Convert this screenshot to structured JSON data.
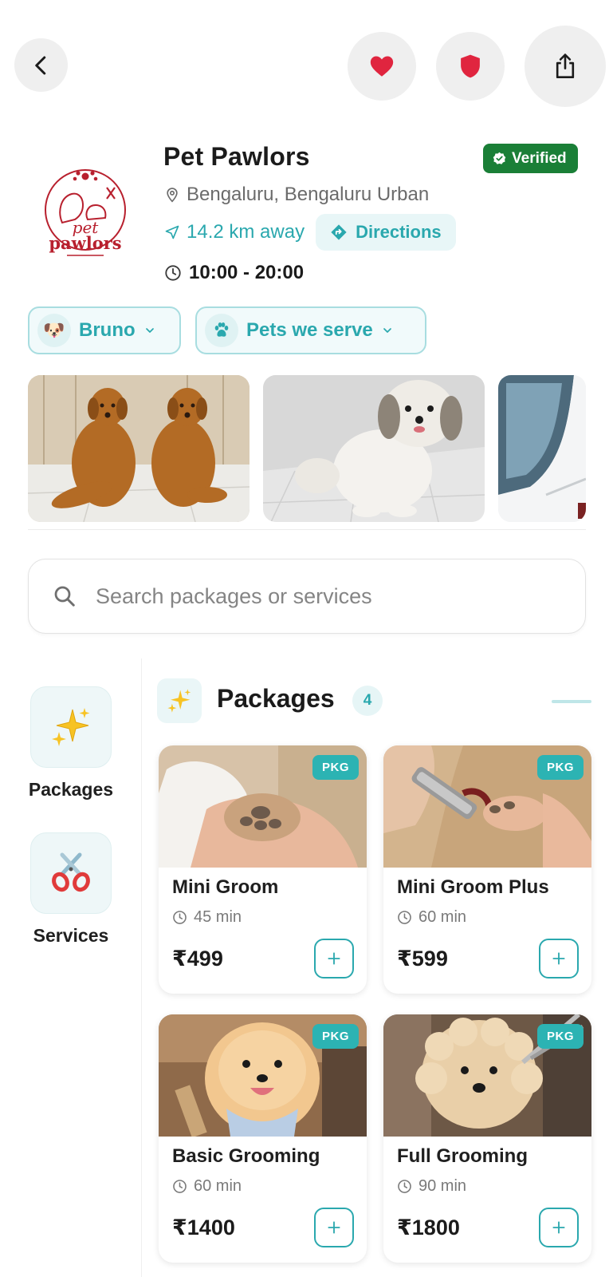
{
  "topbar": {
    "back_icon": "chevron-left-icon",
    "favorite_icon": "heart-icon",
    "shield_icon": "shield-icon",
    "share_icon": "share-icon"
  },
  "store": {
    "name": "Pet Pawlors",
    "logo_text_1": "pet",
    "logo_text_2": "pawlors",
    "verified_label": "Verified",
    "location": "Bengaluru, Bengaluru Urban",
    "distance": "14.2 km away",
    "directions_label": "Directions",
    "hours": "10:00 - 20:00"
  },
  "chips": {
    "pet_label": "Bruno",
    "serve_label": "Pets we serve"
  },
  "search": {
    "placeholder": "Search packages or services"
  },
  "sidebar": {
    "items": [
      {
        "label": "Packages",
        "icon": "sparkles-icon"
      },
      {
        "label": "Services",
        "icon": "scissors-icon"
      }
    ]
  },
  "section": {
    "title": "Packages",
    "count": "4"
  },
  "packages": [
    {
      "name": "Mini Groom",
      "duration": "45 min",
      "price": "₹499",
      "badge": "PKG"
    },
    {
      "name": "Mini Groom Plus",
      "duration": "60 min",
      "price": "₹599",
      "badge": "PKG"
    },
    {
      "name": "Basic Grooming",
      "duration": "60 min",
      "price": "₹1400",
      "badge": "PKG"
    },
    {
      "name": "Full Grooming",
      "duration": "90 min",
      "price": "₹1800",
      "badge": "PKG"
    }
  ],
  "colors": {
    "accent": "#2aa8ae",
    "verified": "#1a7f37",
    "heart": "#e0253f"
  }
}
